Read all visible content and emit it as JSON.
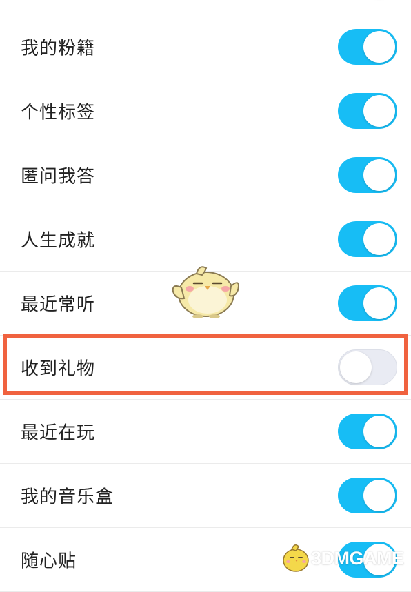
{
  "colors": {
    "toggle_on": "#17bdf5",
    "toggle_off": "#e9ebf3",
    "highlight_border": "#f0623f"
  },
  "settings": [
    {
      "label": "",
      "enabled": true
    },
    {
      "label": "我的粉籍",
      "enabled": true
    },
    {
      "label": "个性标签",
      "enabled": true
    },
    {
      "label": "匿问我答",
      "enabled": true
    },
    {
      "label": "人生成就",
      "enabled": true
    },
    {
      "label": "最近常听",
      "enabled": true
    },
    {
      "label": "收到礼物",
      "enabled": false,
      "highlighted": true
    },
    {
      "label": "最近在玩",
      "enabled": true
    },
    {
      "label": "我的音乐盒",
      "enabled": true
    },
    {
      "label": "随心贴",
      "enabled": true
    }
  ],
  "decorations": {
    "mascot_icon": "yellow-chick-mascot-icon",
    "watermark_text": "3DMGAME"
  }
}
